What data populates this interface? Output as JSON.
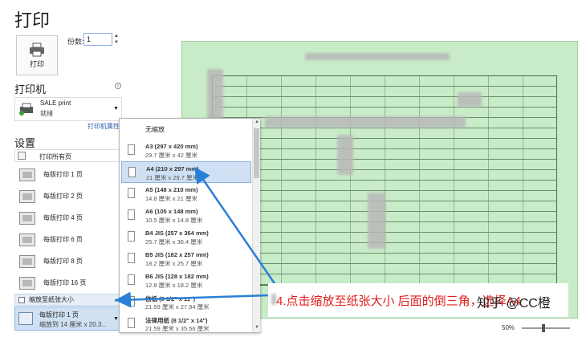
{
  "header": {
    "title": "打印"
  },
  "print_button": {
    "label": "打印"
  },
  "copies": {
    "label": "份数:",
    "value": "1"
  },
  "printer": {
    "section_title": "打印机",
    "name": "SALE print",
    "status": "就绪",
    "properties_link": "打印机属性"
  },
  "settings": {
    "section_title": "设置",
    "print_range": "打印所有页",
    "pages_per_sheet_items": [
      "每版打印 1 页",
      "每版打印 2 页",
      "每版打印 4 页",
      "每版打印 6 页",
      "每版打印 8 页",
      "每版打印 16 页"
    ],
    "scale_to_paper": "缩放至纸张大小",
    "selected_title": "每版打印 1 页",
    "selected_sub": "缩放到 14 厘米 x 20.3..."
  },
  "paper_menu": {
    "header": "无缩放",
    "items": [
      {
        "name": "A3 (297 x 420 mm)",
        "size": "29.7 厘米 x 42 厘米"
      },
      {
        "name": "A4 (210 x 297 mm)",
        "size": "21 厘米 x 29.7 厘米"
      },
      {
        "name": "A5 (148 x 210 mm)",
        "size": "14.8 厘米 x 21 厘米"
      },
      {
        "name": "A6 (105 x 148 mm)",
        "size": "10.5 厘米 x 14.8 厘米"
      },
      {
        "name": "B4 JIS (257 x 364 mm)",
        "size": "25.7 厘米 x 36.4 厘米"
      },
      {
        "name": "B5 JIS (182 x 257 mm)",
        "size": "18.2 厘米 x 25.7 厘米"
      },
      {
        "name": "B6 JIS (128 x 182 mm)",
        "size": "12.8 厘米 x 18.2 厘米"
      },
      {
        "name": "信纸 (8 1/2\" x 11\")",
        "size": "21.59 厘米 x 27.94 厘米"
      },
      {
        "name": "法律用纸 (8 1/2\" x 14\")",
        "size": "21.59 厘米 x 35.56 厘米"
      }
    ],
    "selected_index": 1
  },
  "annotation": {
    "text": "4.点击缩放至纸张大小 后面的倒三角，选择A4",
    "watermark": "知乎 @CC橙"
  },
  "zoom": {
    "level": "50%"
  },
  "colors": {
    "preview_bg": "#c8ecc8",
    "accent": "#2a7fd6",
    "annotation": "#e0201f"
  }
}
